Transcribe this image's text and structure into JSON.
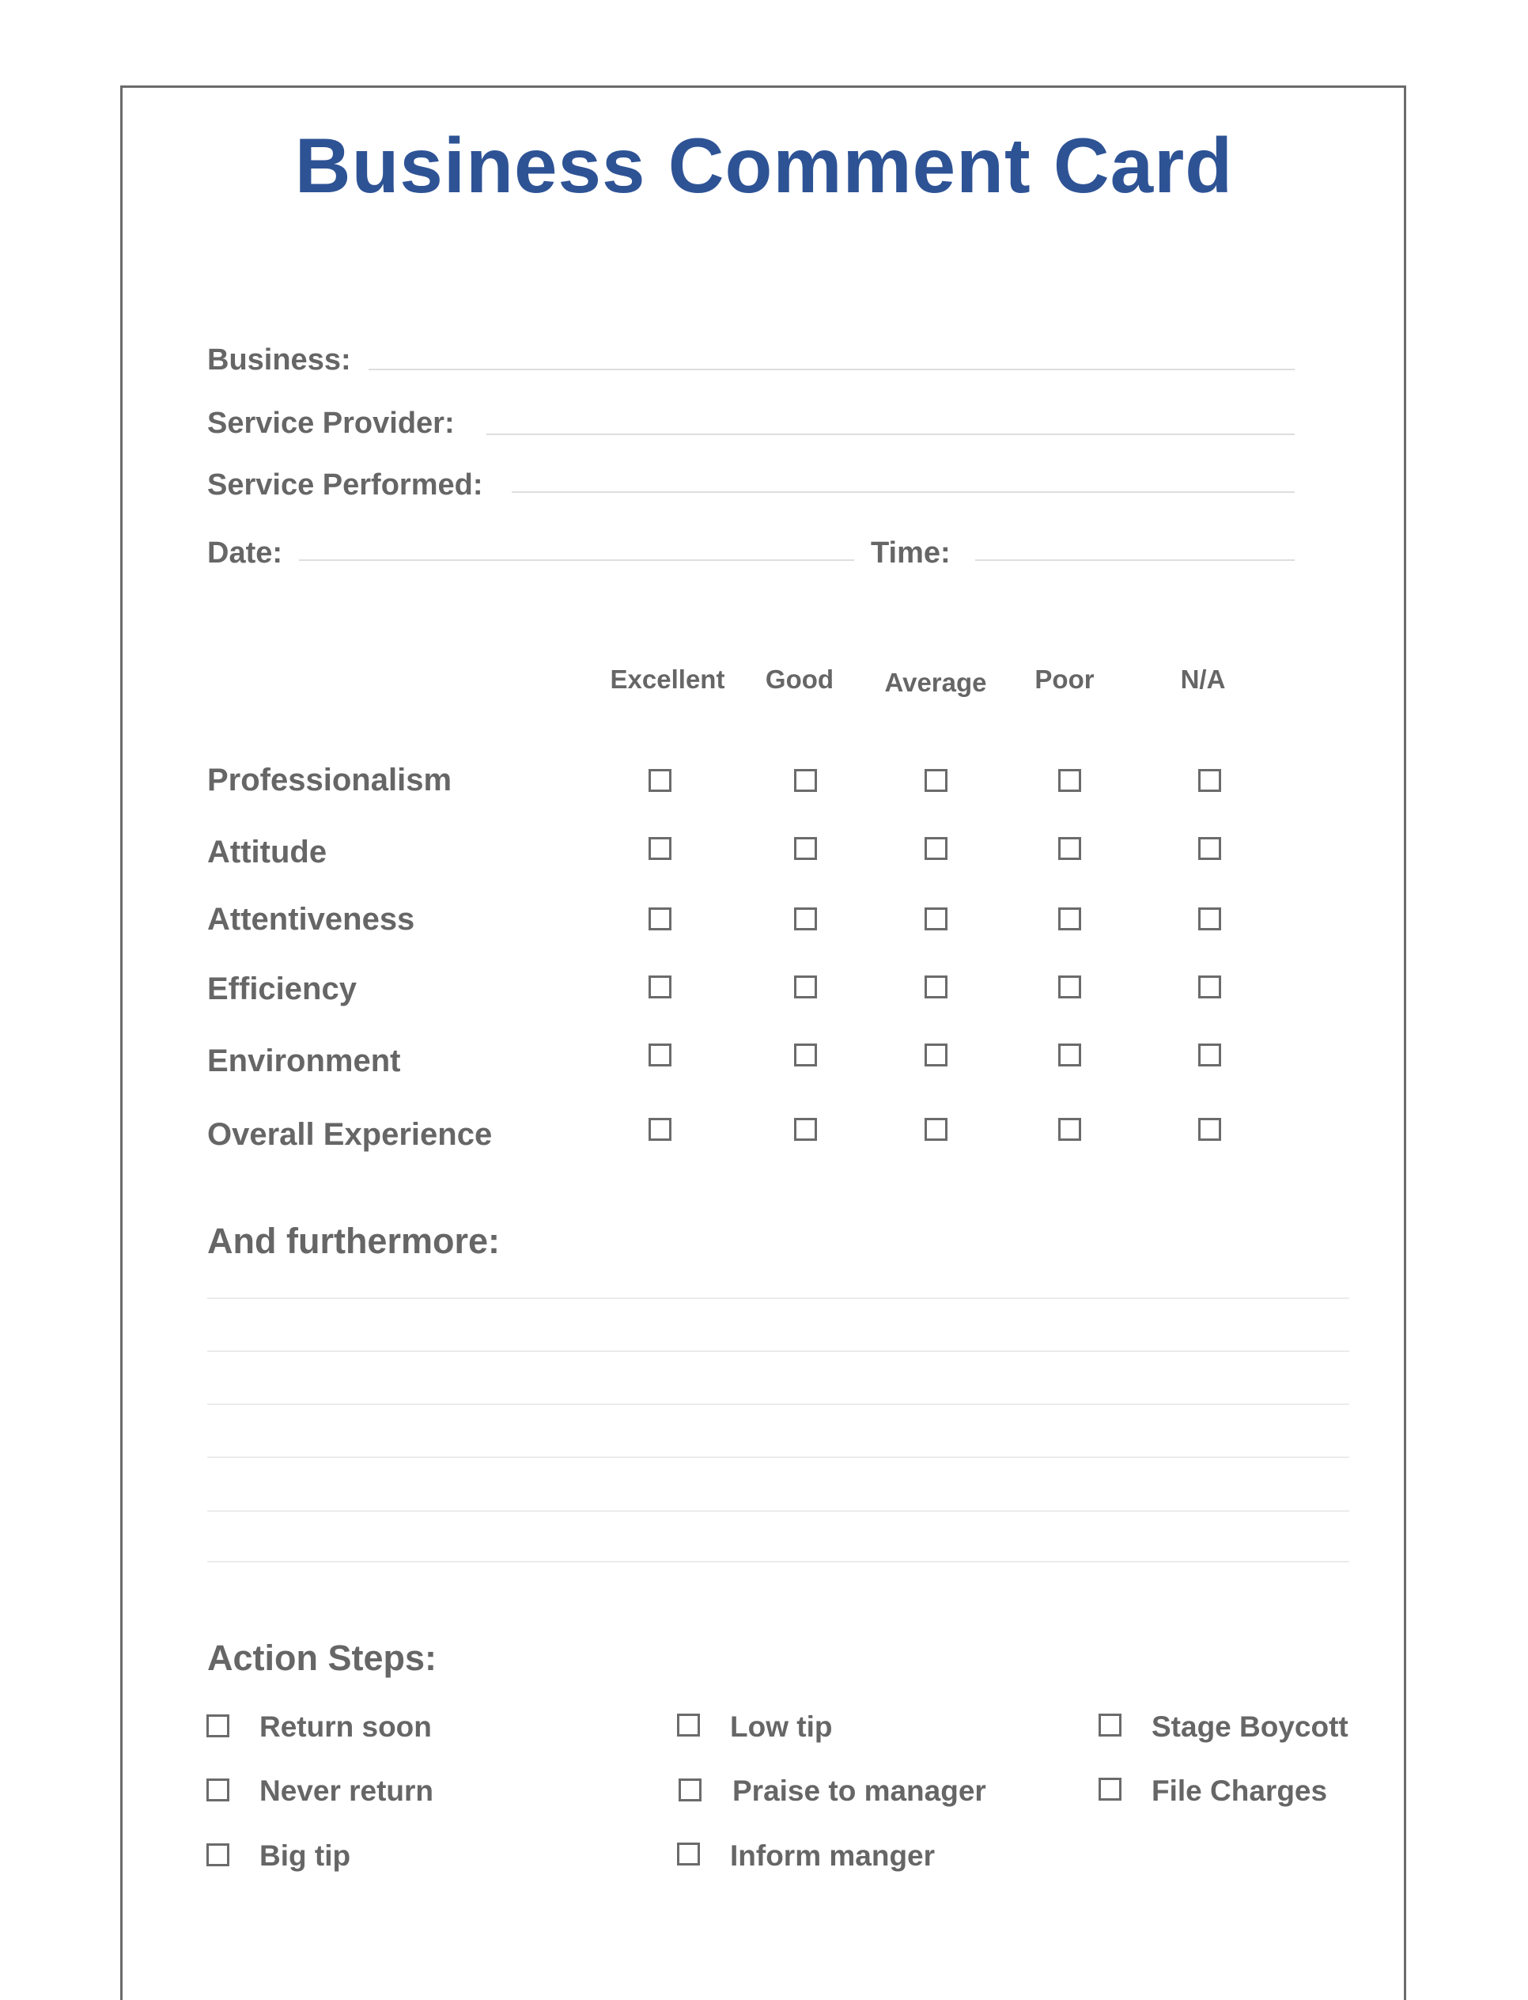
{
  "title": "Business Comment Card",
  "fields": {
    "business": {
      "label": "Business:",
      "value": ""
    },
    "service_provider": {
      "label": "Service Provider:",
      "value": ""
    },
    "service_performed": {
      "label": "Service Performed:",
      "value": ""
    },
    "date": {
      "label": "Date:",
      "value": ""
    },
    "time": {
      "label": "Time:",
      "value": ""
    }
  },
  "ratings": {
    "columns": [
      "Excellent",
      "Good",
      "Average",
      "Poor",
      "N/A"
    ],
    "rows": [
      {
        "label": "Professionalism",
        "selected": null
      },
      {
        "label": "Attitude",
        "selected": null
      },
      {
        "label": "Attentiveness",
        "selected": null
      },
      {
        "label": "Efficiency",
        "selected": null
      },
      {
        "label": "Environment",
        "selected": null
      },
      {
        "label": "Overall Experience",
        "selected": null
      }
    ]
  },
  "comments": {
    "heading": "And furthermore:",
    "lines": [
      "",
      "",
      "",
      "",
      "",
      ""
    ]
  },
  "action_steps": {
    "heading": "Action Steps:",
    "columns": [
      [
        {
          "label": "Return soon",
          "checked": false
        },
        {
          "label": "Never return",
          "checked": false
        },
        {
          "label": "Big tip",
          "checked": false
        }
      ],
      [
        {
          "label": "Low tip",
          "checked": false
        },
        {
          "label": "Praise to manager",
          "checked": false
        },
        {
          "label": "Inform manger",
          "checked": false
        }
      ],
      [
        {
          "label": "Stage Boycott",
          "checked": false
        },
        {
          "label": "File Charges",
          "checked": false
        }
      ]
    ]
  },
  "colors": {
    "title": "#2e5395",
    "text": "#666666",
    "border": "#6b6b6b",
    "rule": "#dedede"
  }
}
